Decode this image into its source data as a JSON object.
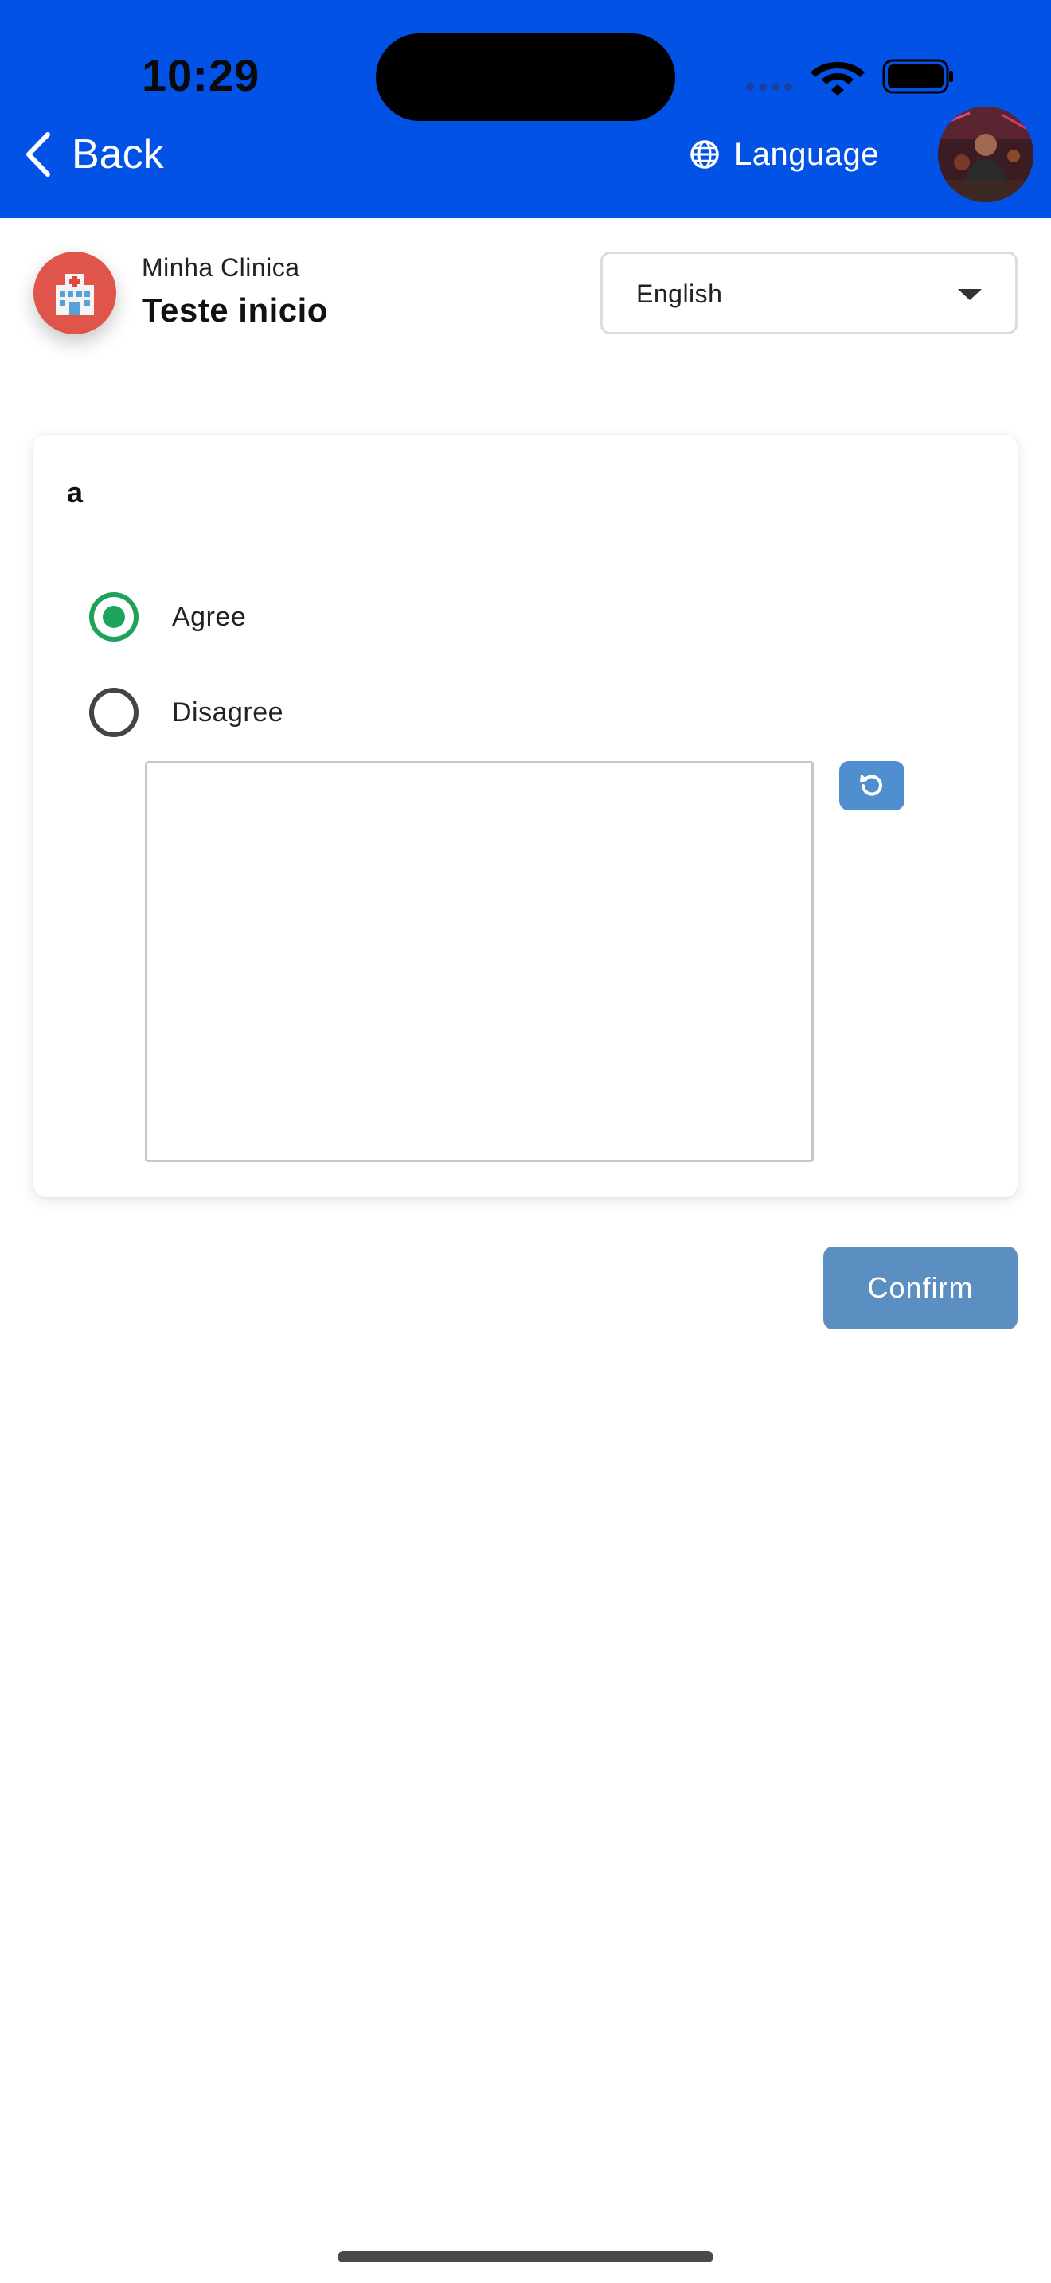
{
  "status_bar": {
    "time": "10:29"
  },
  "header": {
    "back_label": "Back",
    "language_label": "Language",
    "background_color": "#0252e6"
  },
  "clinic": {
    "name": "Minha Clinica",
    "title": "Teste inicio",
    "logo_icon": "hospital-icon"
  },
  "language_select": {
    "selected": "English"
  },
  "question": {
    "text": "a",
    "options": [
      {
        "label": "Agree",
        "selected": true
      },
      {
        "label": "Disagree",
        "selected": false
      }
    ],
    "comment_value": "",
    "selected_color": "#1fa35a",
    "reset_icon": "refresh-icon"
  },
  "actions": {
    "confirm_label": "Confirm",
    "confirm_color": "#5b8fc2"
  }
}
